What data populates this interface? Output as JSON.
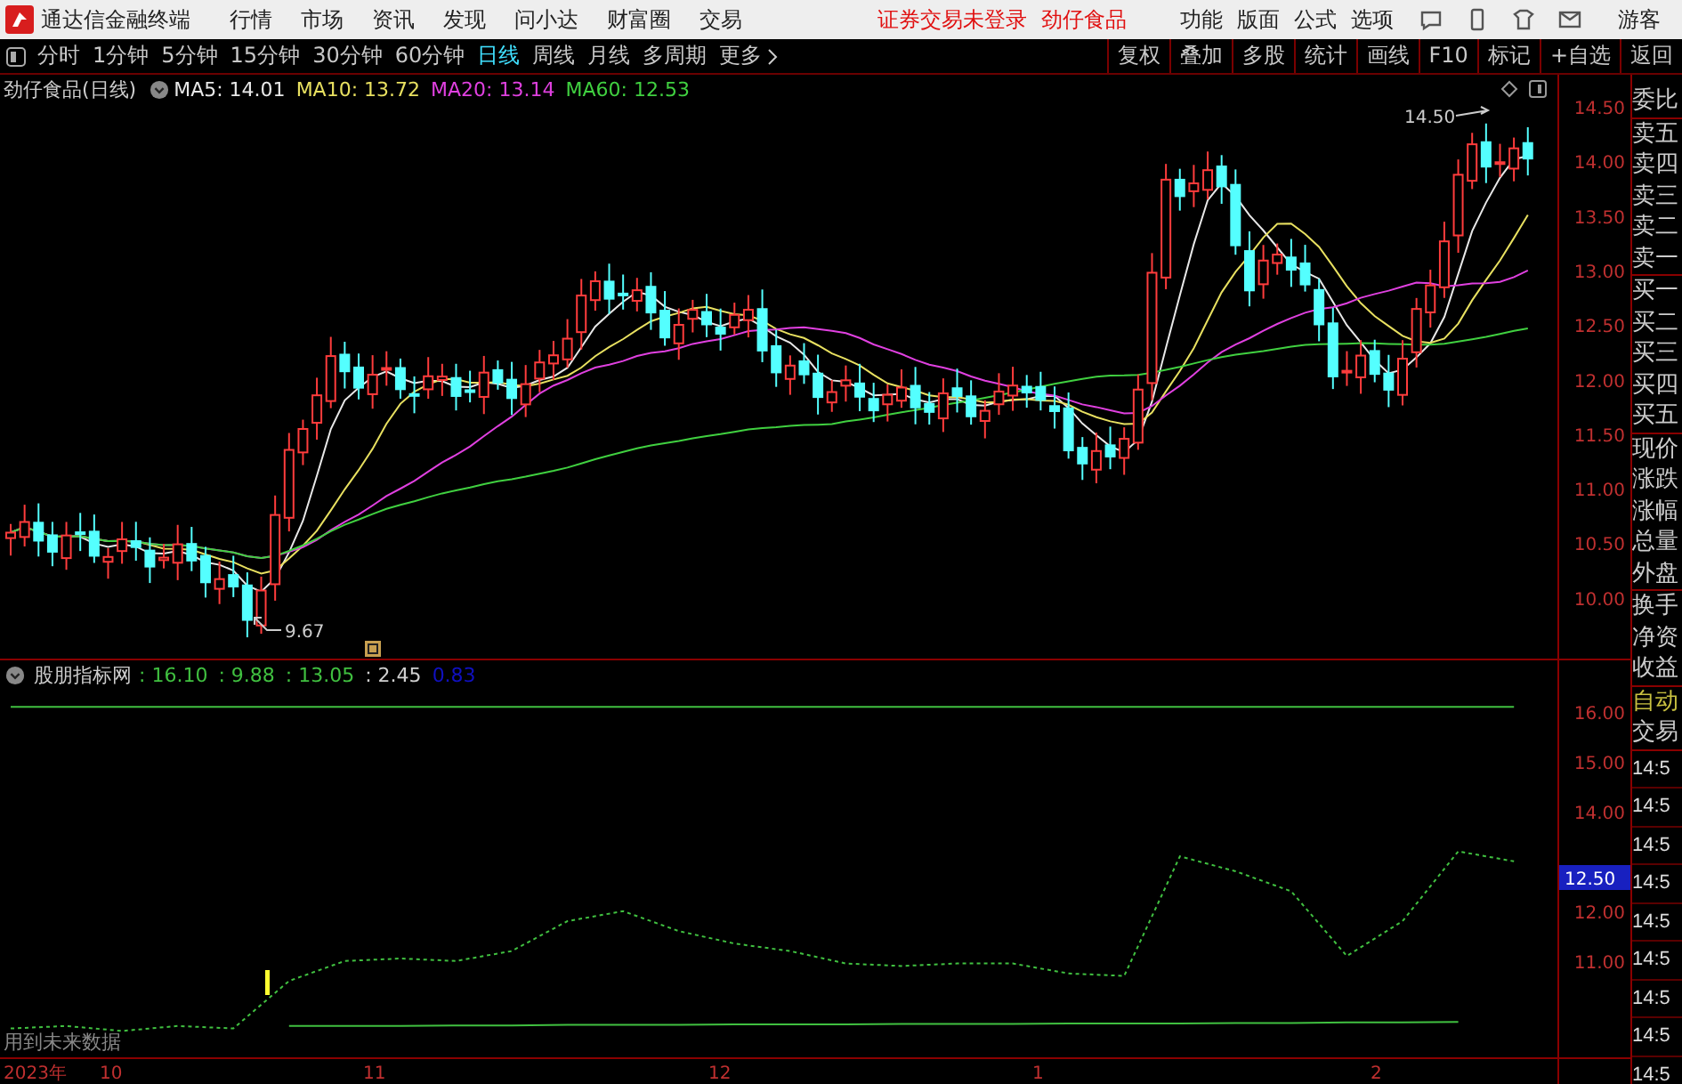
{
  "title_bar": {
    "app_name": "通达信金融终端",
    "menu": [
      "行情",
      "市场",
      "资讯",
      "发现",
      "问小达",
      "财富圈",
      "交易"
    ],
    "notice": "证券交易未登录",
    "stock": "劲仔食品",
    "right_menu": [
      "功能",
      "版面",
      "公式",
      "选项"
    ],
    "user": "游客"
  },
  "period_tabs": [
    {
      "label": "分时",
      "selected": false
    },
    {
      "label": "1分钟",
      "selected": false
    },
    {
      "label": "5分钟",
      "selected": false
    },
    {
      "label": "15分钟",
      "selected": false
    },
    {
      "label": "30分钟",
      "selected": false
    },
    {
      "label": "60分钟",
      "selected": false
    },
    {
      "label": "日线",
      "selected": true
    },
    {
      "label": "周线",
      "selected": false
    },
    {
      "label": "月线",
      "selected": false
    },
    {
      "label": "多周期",
      "selected": false
    }
  ],
  "more": "更多",
  "tools": [
    "复权",
    "叠加",
    "多股",
    "统计",
    "画线",
    "F10",
    "标记",
    "+自选",
    "返回"
  ],
  "main_chart": {
    "title": "劲仔食品(日线)",
    "ma": [
      {
        "label": "MA5: 14.01",
        "color": "#e8e8e8"
      },
      {
        "label": "MA10: 13.72",
        "color": "#e8e060"
      },
      {
        "label": "MA20: 13.14",
        "color": "#e040e0"
      },
      {
        "label": "MA60: 12.53",
        "color": "#40d040"
      }
    ],
    "y_axis": [
      "14.50",
      "14.00",
      "13.50",
      "13.00",
      "12.50",
      "12.00",
      "11.50",
      "11.00",
      "10.50",
      "10.00"
    ],
    "high_label": "14.50",
    "low_label": "9.67"
  },
  "indicator": {
    "name": "股朋指标网",
    "values": [
      {
        "text": ": 16.10",
        "color": "#40c040"
      },
      {
        "text": ": 9.88",
        "color": "#40c040"
      },
      {
        "text": ": 13.05",
        "color": "#40c040"
      },
      {
        "text": ": 2.45",
        "color": "#d0d0d0"
      },
      {
        "text": "0.83",
        "color": "#1010c0"
      }
    ],
    "current_badge": "12.50",
    "note": "用到未来数据",
    "chart_data": {
      "type": "line",
      "ylim": [
        9.07,
        16.46
      ],
      "yticks": [
        {
          "value": 16,
          "label": "16.00"
        },
        {
          "value": 15,
          "label": "15.00"
        },
        {
          "value": 14,
          "label": "14.00"
        },
        {
          "value": 12,
          "label": "12.00"
        },
        {
          "value": 11,
          "label": "11.00"
        }
      ],
      "series": [
        {
          "color": "#40c040",
          "line_style": "dashed",
          "values": [
            9.65,
            9.7,
            9.6,
            9.7,
            9.65,
            10.6,
            11.0,
            11.05,
            11.0,
            11.2,
            11.8,
            12.0,
            11.6,
            11.35,
            11.2,
            10.95,
            10.9,
            10.95,
            10.95,
            10.75,
            10.7,
            13.1,
            12.8,
            12.4,
            11.1,
            11.8,
            13.2,
            13.0
          ]
        },
        {
          "color": "#40c040",
          "values": [
            16.1,
            16.1,
            16.1,
            16.1,
            16.1,
            16.1,
            16.1,
            16.1,
            16.1,
            16.1,
            16.1,
            16.1,
            16.1,
            16.1,
            16.1,
            16.1,
            16.1,
            16.1,
            16.1,
            16.1,
            16.1,
            16.1,
            16.1,
            16.1,
            16.1,
            16.1,
            16.1,
            16.1
          ]
        },
        {
          "color": "#40c040",
          "values": [
            null,
            null,
            null,
            null,
            null,
            9.7,
            9.7,
            9.7,
            9.71,
            9.71,
            9.72,
            9.72,
            9.72,
            9.73,
            9.73,
            9.73,
            9.74,
            9.74,
            9.74,
            9.75,
            9.75,
            9.75,
            9.76,
            9.76,
            9.77,
            9.77,
            9.78,
            null
          ]
        }
      ]
    }
  },
  "x_axis": [
    "2023年",
    "10",
    "11",
    "12",
    "1",
    "2"
  ],
  "side_panel": {
    "quote_labels": [
      "委比",
      "卖五",
      "卖四",
      "卖三",
      "卖二",
      "卖一",
      "买一",
      "买二",
      "买三",
      "买四",
      "买五",
      "现价",
      "涨跌",
      "涨幅",
      "总量",
      "外盘",
      "换手",
      "净资",
      "收益"
    ],
    "auto_label": "自动",
    "trade_label": "交易",
    "times": [
      "14:5",
      "14:5",
      "14:5",
      "14:5",
      "14:5",
      "14:5",
      "14:5",
      "14:5",
      "14:5"
    ]
  }
}
